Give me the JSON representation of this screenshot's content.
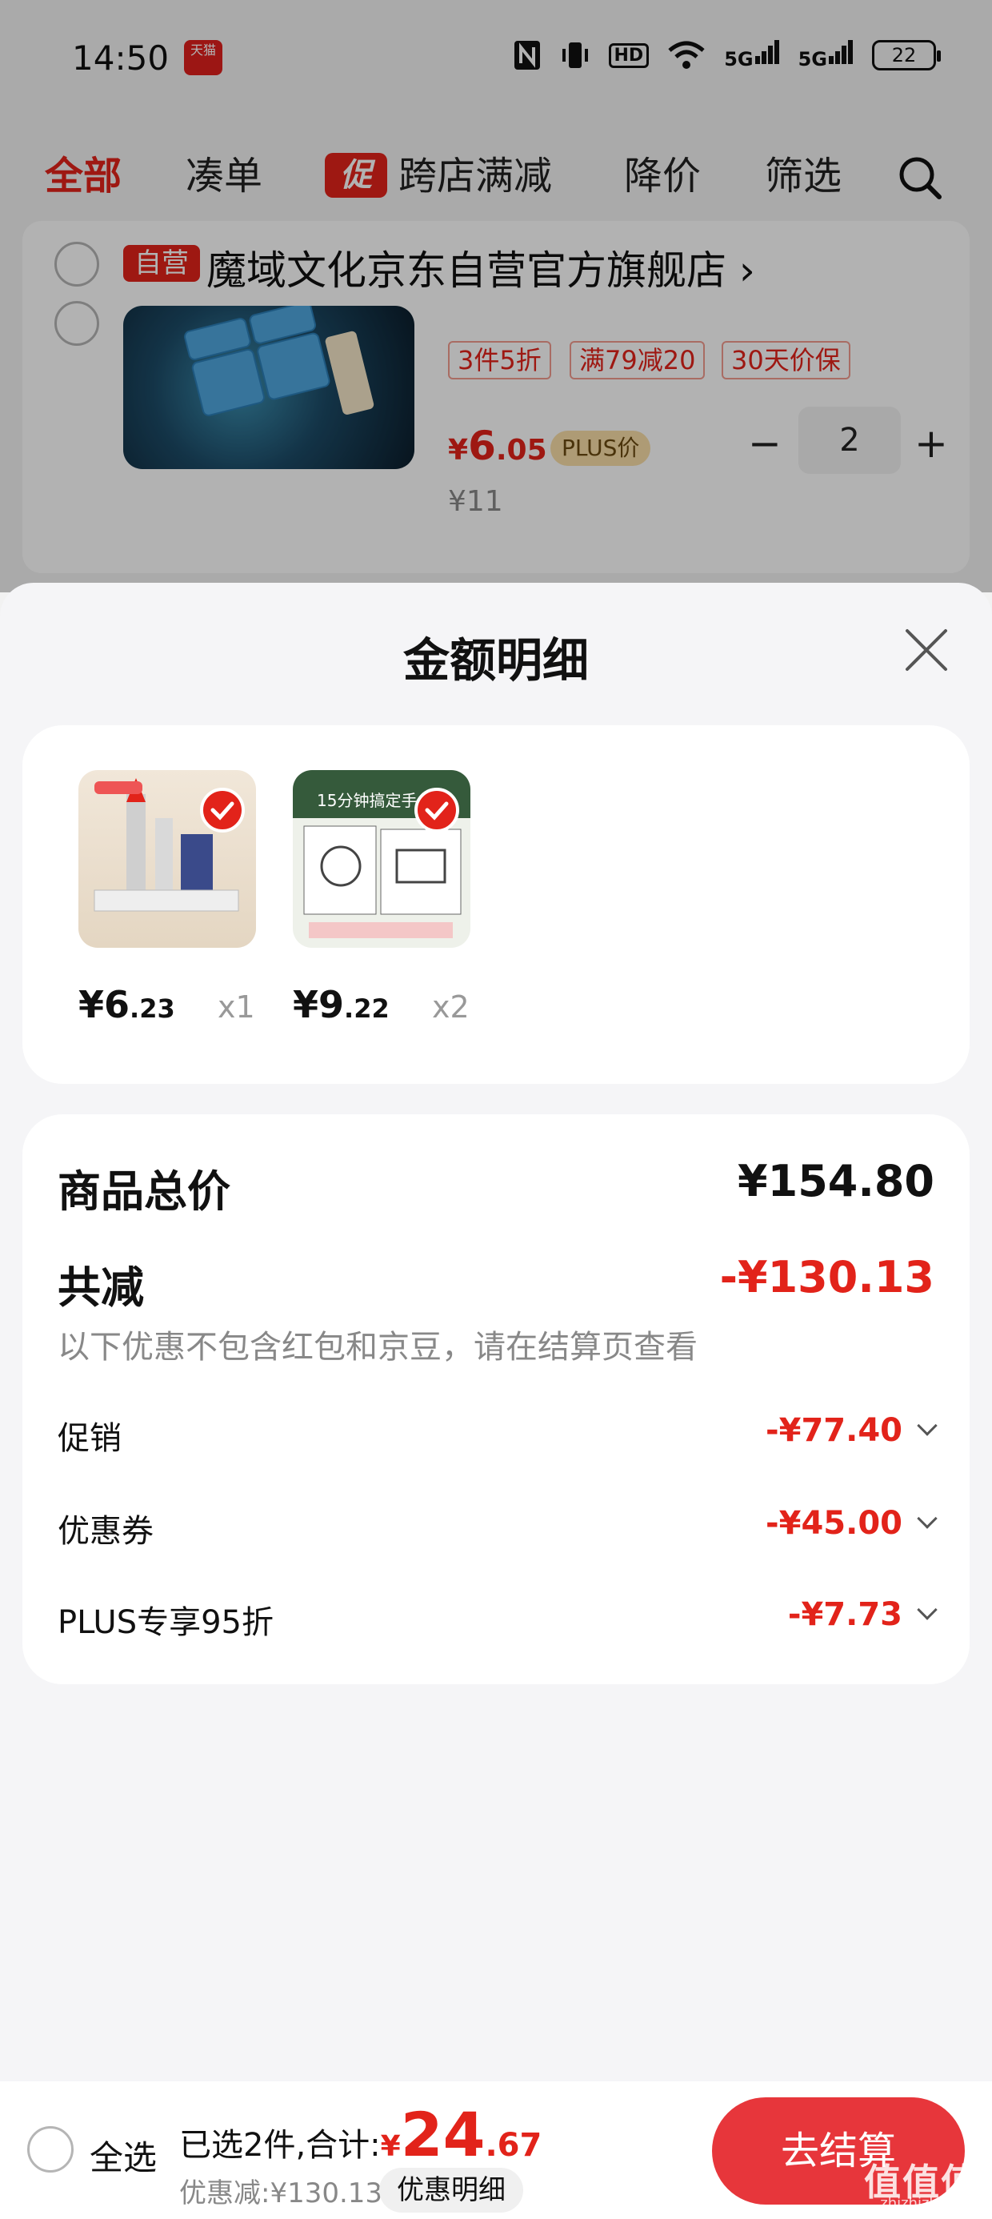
{
  "status_bar": {
    "time": "14:50",
    "app_badge": "天猫",
    "battery": "22",
    "icons": [
      "nfc-icon",
      "vibrate-icon",
      "hd-icon",
      "wifi-icon",
      "signal-5g-icon",
      "signal-5g-icon",
      "battery-icon"
    ],
    "hd_label": "HD",
    "sig1": "5G",
    "sig2": "5G"
  },
  "tabs": [
    {
      "label": "全部",
      "active": true
    },
    {
      "label": "凑单"
    },
    {
      "label": "跨店满减",
      "badge": "促"
    },
    {
      "label": "降价"
    },
    {
      "label": "筛选"
    }
  ],
  "store": {
    "badge": "自营",
    "name": "魔域文化京东自营官方旗舰店",
    "arrow": "›",
    "tags": [
      "3件5折",
      "满79减20",
      "30天价保"
    ],
    "price_symbol": "¥",
    "price_int": "6",
    "price_dec": ".05",
    "plus_label": "PLUS价",
    "quantity": "2",
    "minus": "−",
    "plus": "+",
    "original_price": "¥11"
  },
  "sheet": {
    "title": "金额明细",
    "items": [
      {
        "price_symbol": "¥",
        "price_int": "6",
        "price_dec": ".23",
        "qty": "x1"
      },
      {
        "price_symbol": "¥",
        "price_int": "9",
        "price_dec": ".22",
        "qty": "x2",
        "thumb_text": "15分钟搞定手"
      }
    ],
    "summary": {
      "total_label": "商品总价",
      "total_value": "¥154.80",
      "discount_label": "共减",
      "discount_value": "-¥130.13",
      "note": "以下优惠不包含红包和京豆，请在结算页查看",
      "rows": [
        {
          "label": "促销",
          "value": "-¥77.40"
        },
        {
          "label": "优惠券",
          "value": "-¥45.00"
        },
        {
          "label": "PLUS专享95折",
          "value": "-¥7.73"
        }
      ]
    }
  },
  "bottom_bar": {
    "select_all": "全选",
    "selected_text": "已选2件,合计:",
    "total_symbol": "¥",
    "total_int": "24",
    "total_dec": ".67",
    "saved_text": "优惠减:¥130.13",
    "detail_pill": "优惠明细",
    "checkout": "去结算"
  },
  "watermark": {
    "main": "值值值",
    "sub": "zhizhizhi.com"
  },
  "colors": {
    "accent": "#e2231a",
    "checkout": "#e7363b",
    "plus_badge": "#f9dfa8"
  }
}
